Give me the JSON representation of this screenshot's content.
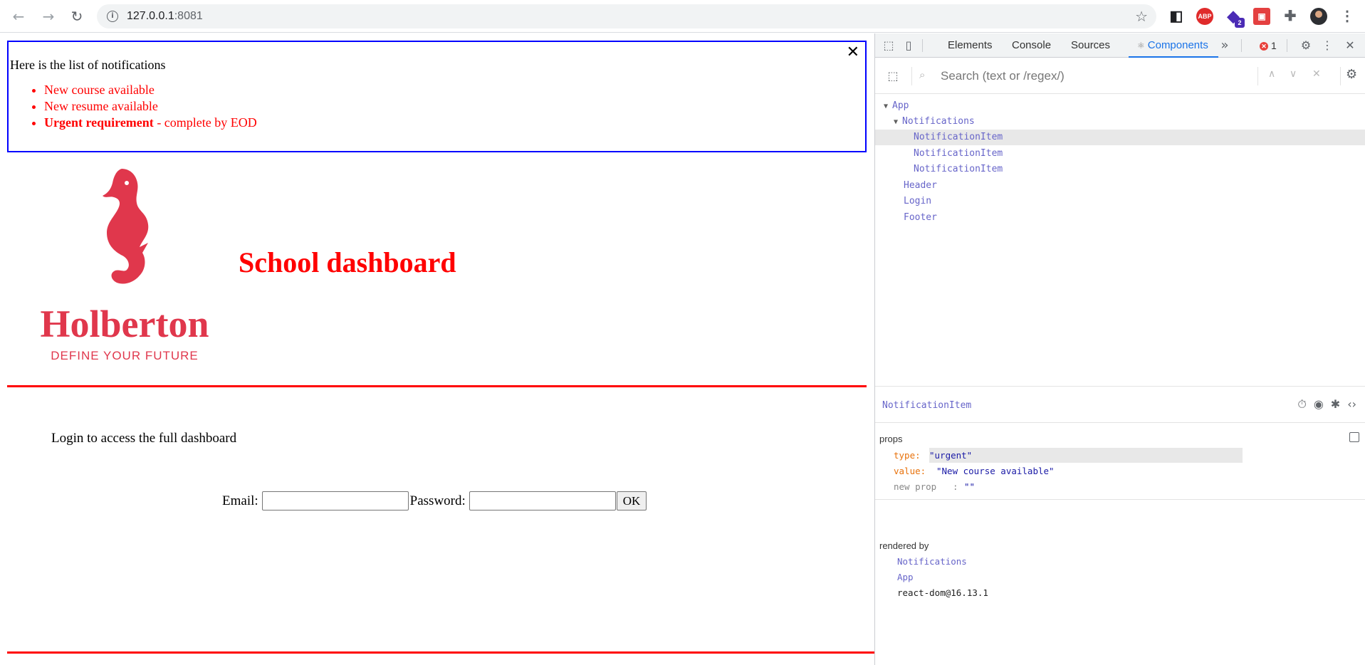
{
  "browser": {
    "url_host": "127.0.0.1",
    "url_port": ":8081",
    "back_icon": "←",
    "forward_icon": "→",
    "reload_icon": "↻",
    "info_icon": "i",
    "star_icon": "☆",
    "reader_icon": "◧",
    "abp_label": "ABP",
    "ext_badge_count": "2",
    "menu_icon": "⋮",
    "puzzle_icon": "✚"
  },
  "notifications": {
    "close_icon": "✕",
    "intro": "Here is the list of notifications",
    "items": [
      {
        "text": "New course available"
      },
      {
        "text": "New resume available"
      },
      {
        "strong": "Urgent requirement",
        "rest": " - complete by EOD"
      }
    ]
  },
  "header": {
    "logo_name": "Holberton",
    "logo_tagline": "DEFINE YOUR FUTURE",
    "title": "School dashboard"
  },
  "login": {
    "message": "Login to access the full dashboard",
    "email_label": "Email:",
    "password_label": "Password:",
    "ok_label": "OK"
  },
  "devtools": {
    "tabs": [
      "Elements",
      "Console",
      "Sources",
      "Components"
    ],
    "active_tab": "Components",
    "more_icon": "»",
    "error_count": "1",
    "search_placeholder": "Search (text or /regex/)",
    "tree": [
      {
        "label": "App",
        "caret": "▼",
        "depth": 0
      },
      {
        "label": "Notifications",
        "caret": "▼",
        "depth": 1
      },
      {
        "label": "NotificationItem",
        "caret": "",
        "depth": 2,
        "selected": true
      },
      {
        "label": "NotificationItem",
        "caret": "",
        "depth": 2
      },
      {
        "label": "NotificationItem",
        "caret": "",
        "depth": 2
      },
      {
        "label": "Header",
        "caret": "",
        "depth": 1
      },
      {
        "label": "Login",
        "caret": "",
        "depth": 1
      },
      {
        "label": "Footer",
        "caret": "",
        "depth": 1
      }
    ],
    "inspected_component": "NotificationItem",
    "props_label": "props",
    "props": [
      {
        "key": "type",
        "value": "\"urgent\""
      },
      {
        "key": "value",
        "value": "\"New course available\""
      }
    ],
    "new_prop_label": "new prop",
    "new_prop_colon": ":",
    "new_prop_value": "\"\"",
    "rendered_by_label": "rendered by",
    "rendered_by": [
      "Notifications",
      "App",
      "react-dom@16.13.1"
    ]
  },
  "colors": {
    "accent_red": "#ff0000",
    "notification_border": "#0000ff",
    "logo_red": "#e0374c",
    "devtools_component": "#6765c9"
  }
}
